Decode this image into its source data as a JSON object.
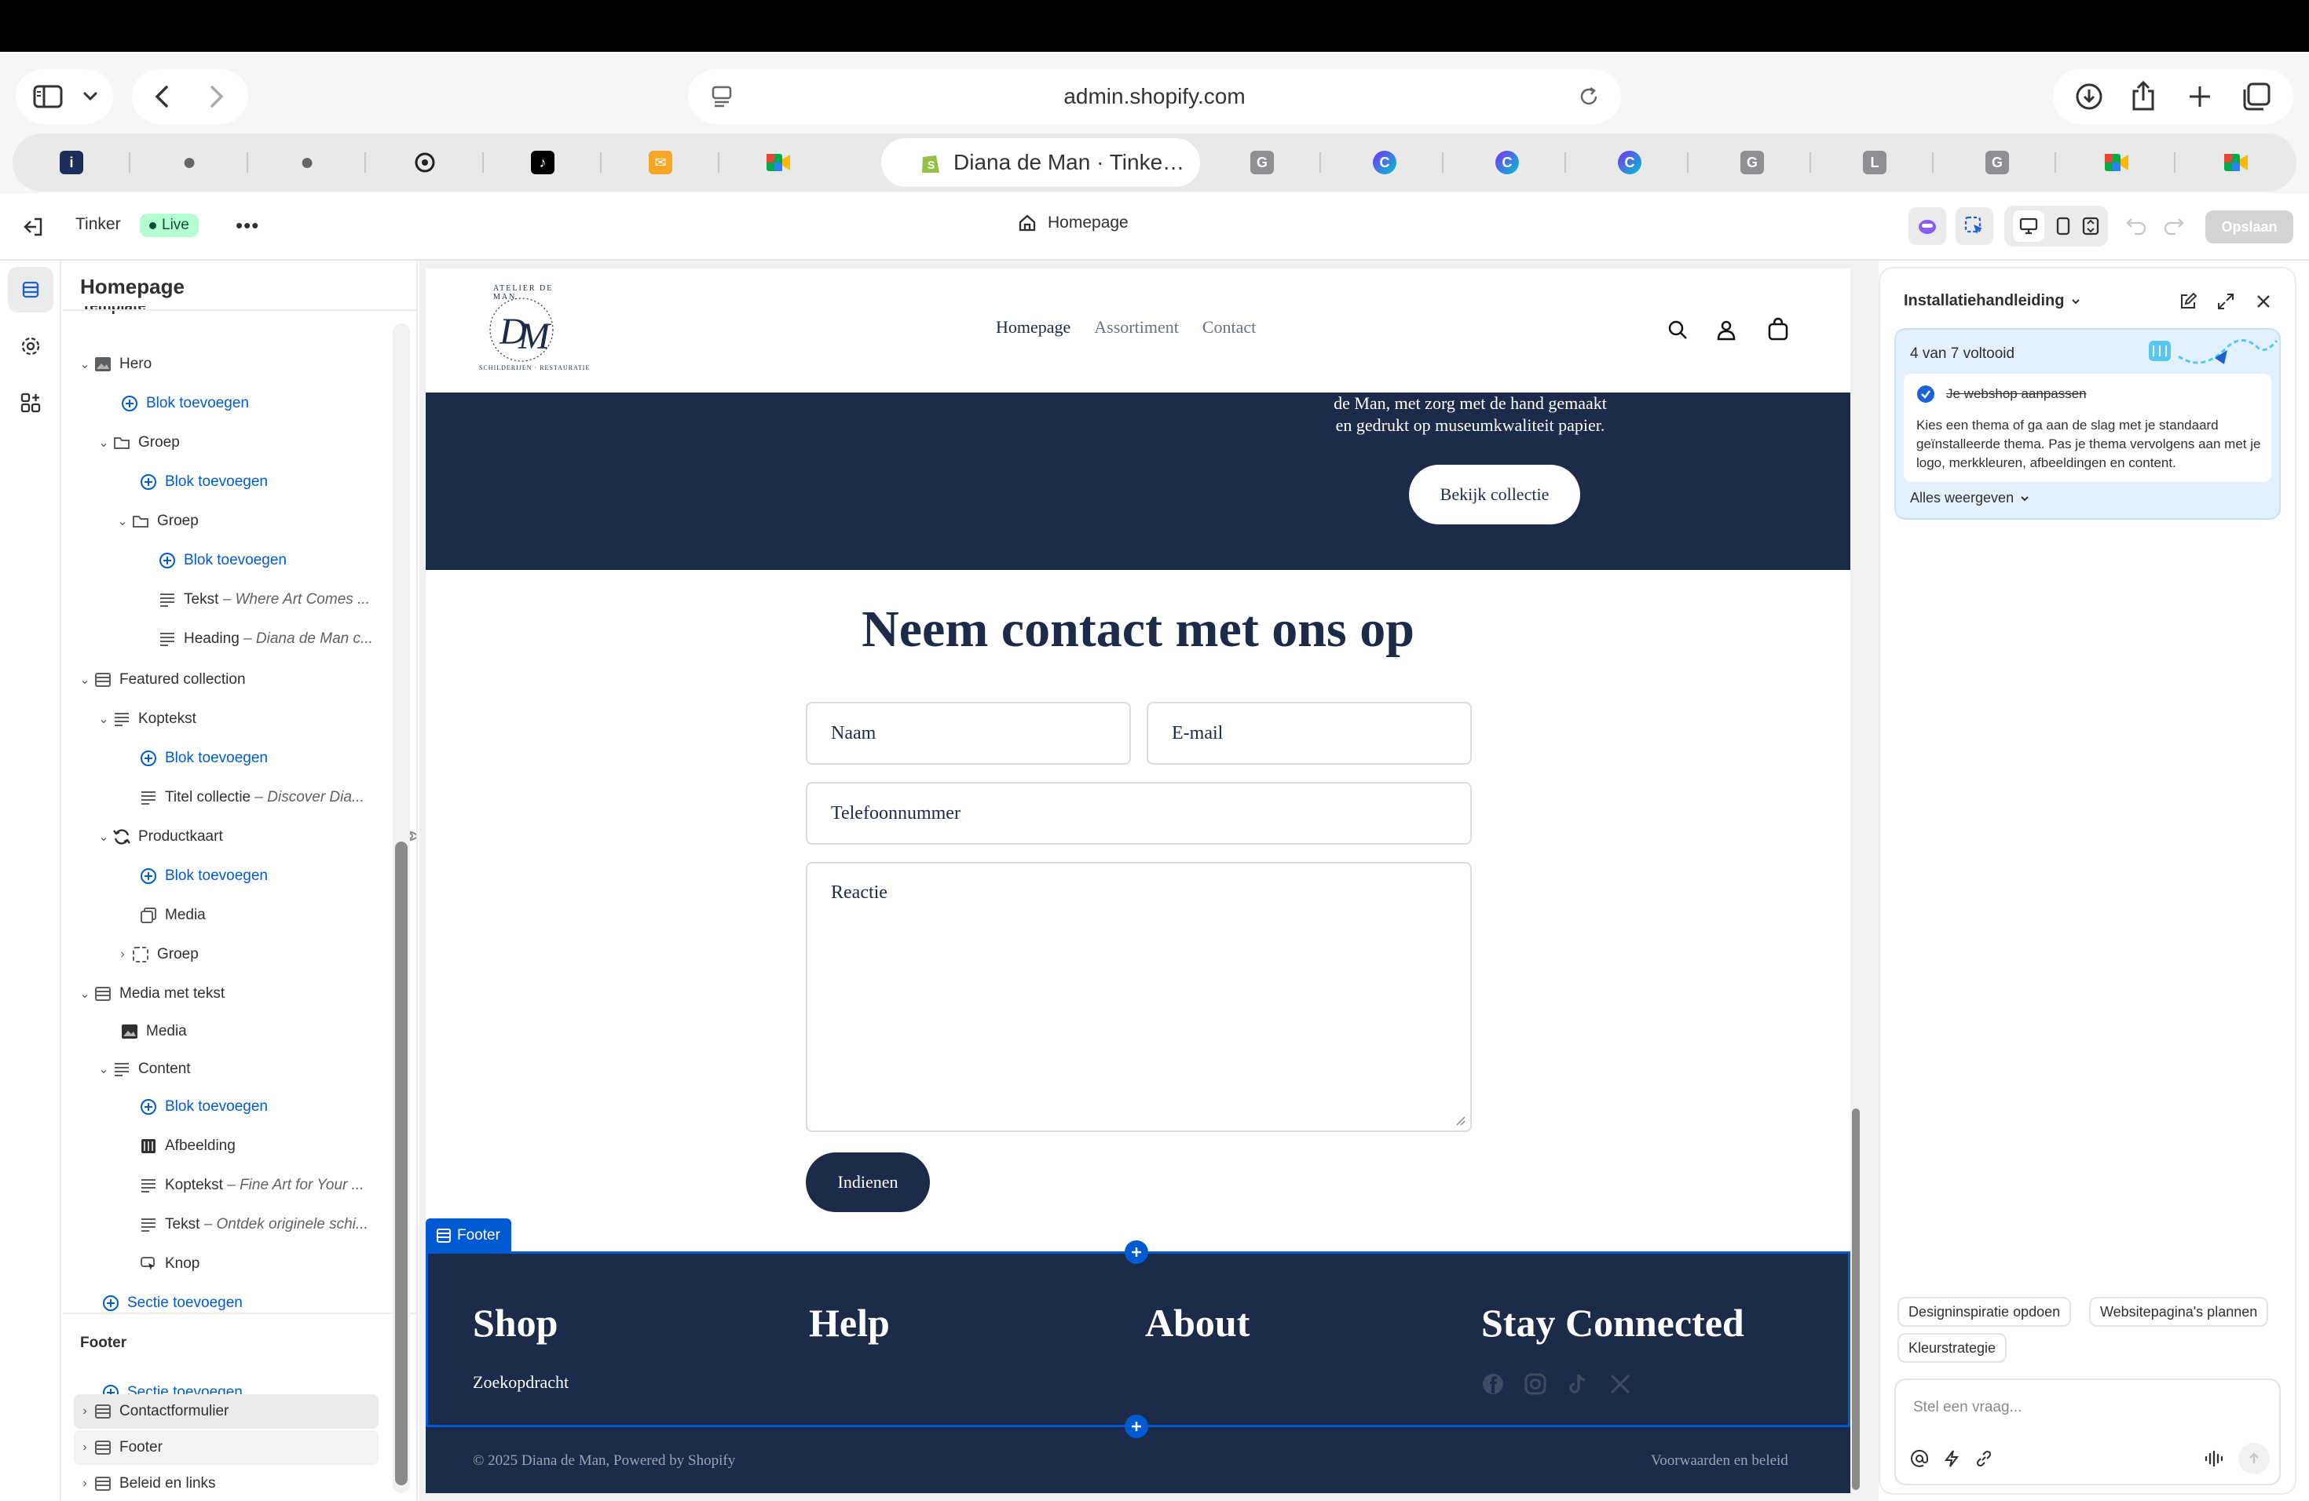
{
  "browser": {
    "url": "admin.shopify.com",
    "active_tab_title": "Diana de Man · Tinke…",
    "tab_letters": [
      "G",
      "G",
      "L",
      "G"
    ]
  },
  "editor": {
    "theme_name": "Tinker",
    "live_badge": "Live",
    "page_selector": "Homepage",
    "save_button": "Opslaan"
  },
  "tree": {
    "title": "Homepage",
    "partial_label": "Template",
    "hero": "Hero",
    "add_block": "Blok toevoegen",
    "group": "Groep",
    "tekst": "Tekst",
    "tekst_sub": "– Where Art Comes ...",
    "heading": "Heading",
    "heading_sub": "– Diana de Man c...",
    "featured": "Featured collection",
    "koptekst": "Koptekst",
    "titel_collectie": "Titel collectie",
    "titel_collectie_sub": "– Discover Dia...",
    "productkaart": "Productkaart",
    "media": "Media",
    "media_met_tekst": "Media met tekst",
    "content": "Content",
    "afbeelding": "Afbeelding",
    "koptekst2_sub": "– Fine Art for Your ...",
    "tekst2_sub": "– Ontdek originele schi...",
    "knop": "Knop",
    "add_section": "Sectie toevoegen",
    "footer_heading": "Footer",
    "contactformulier": "Contactformulier",
    "footer_item": "Footer",
    "beleid": "Beleid en links"
  },
  "site": {
    "logo_text_top": "ATELIER DE MAN",
    "logo_text_bottom": "SCHILDERIJEN · RESTAURATIE",
    "logo_mono": "DM",
    "nav": [
      "Homepage",
      "Assortiment",
      "Contact"
    ],
    "hero_text_line1": "de Man, met zorg met de hand gemaakt",
    "hero_text_line2": "en gedrukt op museumkwaliteit papier.",
    "hero_button": "Bekijk collectie",
    "contact_title": "Neem contact met ons op",
    "name_placeholder": "Naam",
    "email_placeholder": "E-mail",
    "phone_placeholder": "Telefoonnummer",
    "comment_placeholder": "Reactie",
    "submit": "Indienen",
    "footer_tag": "Footer",
    "footer_cols": [
      "Shop",
      "Help",
      "About",
      "Stay Connected"
    ],
    "footer_link": "Zoekopdracht",
    "copyright": "© 2025 Diana de Man, Powered by Shopify",
    "policies": "Voorwaarden en beleid",
    "navy": "#1c2b49"
  },
  "panel": {
    "title": "Installatiehandleiding",
    "progress": "4 van 7 voltooid",
    "task_done": "Je webshop aanpassen",
    "task_desc": "Kies een thema of ga aan de slag met je standaard geïnstalleerde thema. Pas je thema vervolgens aan met je logo, merkkleuren, afbeeldingen en content.",
    "show_all": "Alles weergeven",
    "chips": [
      "Designinspiratie opdoen",
      "Websitepagina's plannen",
      "Kleurstrategie"
    ],
    "ask_placeholder": "Stel een vraag..."
  }
}
